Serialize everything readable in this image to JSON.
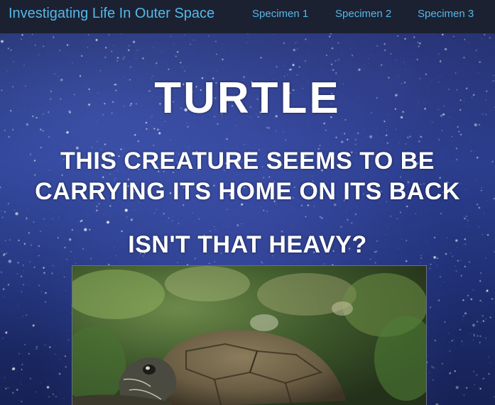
{
  "navbar": {
    "brand": "Investigating Life In Outer Space",
    "links": [
      "Specimen 1",
      "Specimen 2",
      "Specimen 3"
    ]
  },
  "hero": {
    "title": "TURTLE",
    "subtitle": "THIS CREATURE SEEMS TO BE CARRYING ITS HOME ON ITS BACK",
    "question": "ISN'T THAT HEAVY?"
  },
  "photo": {
    "subject": "turtle"
  },
  "colors": {
    "navbar_bg": "#1b2131",
    "link": "#55b8e8",
    "heading": "#ffffff",
    "sky": "#243a86"
  }
}
